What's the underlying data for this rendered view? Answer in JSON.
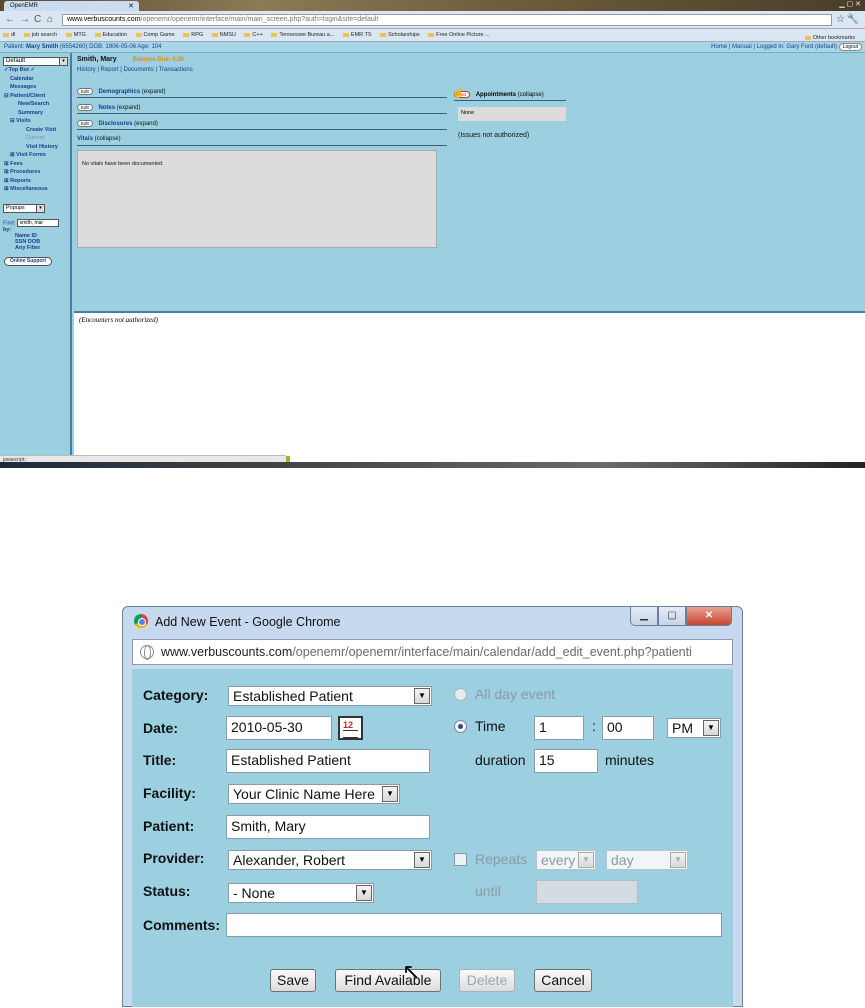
{
  "browser": {
    "tab_title": "OpenEMR",
    "url_domain": "www.verbuscounts.com",
    "url_path": "/openemr/openemr/interface/main/main_screen.php?auth=login&site=default",
    "bookmarks": [
      "dl",
      "job search",
      "MTG",
      "Education",
      "Comp Game",
      "RPG",
      "NMSU",
      "C++",
      "Tennessee Bureau a...",
      "EMR TS",
      "Scholarships",
      "Free Online Picture ..."
    ],
    "other_bookmarks": "Other bookmarks",
    "status_text": "javascript:;"
  },
  "patient_bar": {
    "label": "Patient:",
    "name": "Mary Smith",
    "details": "(6554260) DOB: 1906-05-06 Age: 104",
    "home": "Home",
    "manual": "Manual",
    "logged_in": "Logged in: Gary Ford (default)",
    "logout": "Logout"
  },
  "nav": {
    "view_select": "Default",
    "items": [
      {
        "label": "✓Top      Bot ✓",
        "level": 0
      },
      {
        "label": "Calendar",
        "level": 1
      },
      {
        "label": "Messages",
        "level": 1
      },
      {
        "label": "⊟ Patient/Client",
        "level": 0
      },
      {
        "label": "New/Search",
        "level": 2
      },
      {
        "label": "Summary",
        "level": 2
      },
      {
        "label": "⊟ Visits",
        "level": 1
      },
      {
        "label": "Create Visit",
        "level": 3
      },
      {
        "label": "Current",
        "level": 3,
        "gray": true
      },
      {
        "label": "Visit History",
        "level": 3
      },
      {
        "label": "⊞ Visit Forms",
        "level": 1
      },
      {
        "label": "⊞ Fees",
        "level": 0
      },
      {
        "label": "⊞ Procedures",
        "level": 0
      },
      {
        "label": "⊞ Reports",
        "level": 0
      },
      {
        "label": "⊞ Miscellaneous",
        "level": 0
      }
    ],
    "popups": "Popups",
    "find_label": "Find:",
    "find_value": "smith, mar",
    "by_label": "by:",
    "by_row1": "Name      ID",
    "by_row2": "SSN     DOB",
    "by_row3": "Any    Filter",
    "online_support": "Online Support"
  },
  "main": {
    "patient_name": "Smith, Mary",
    "balance": "Balance Due: 0.00",
    "links": "History | Report | Documents | Transactions",
    "edit": "Edit",
    "demographics": "Demographics",
    "demographics_toggle": "(expand)",
    "notes": "Notes",
    "notes_toggle": "(expand)",
    "disclosures": "Disclosures",
    "disclosures_toggle": "(expand)",
    "vitals": "Vitals",
    "vitals_toggle": "(collapse)",
    "vitals_empty": "No vitals have been documented.",
    "add": "Add",
    "appointments": "Appointments",
    "appointments_toggle": "(collapse)",
    "appointments_none": "None",
    "issues": "(Issues not authorized)",
    "encounters": "(Encounters not authorized)"
  },
  "dialog": {
    "title": "Add New Event - Google Chrome",
    "url_domain": "www.verbuscounts.com",
    "url_path": "/openemr/openemr/interface/main/calendar/add_edit_event.php?patienti",
    "category_label": "Category:",
    "category_value": "Established Patient",
    "date_label": "Date:",
    "date_value": "2010-05-30",
    "title_label": "Title:",
    "title_value": "Established Patient",
    "facility_label": "Facility:",
    "facility_value": "Your Clinic Name Here",
    "patient_label": "Patient:",
    "patient_value": "Smith, Mary",
    "provider_label": "Provider:",
    "provider_value": "Alexander, Robert",
    "status_label": "Status:",
    "status_value": "- None",
    "comments_label": "Comments:",
    "comments_value": "",
    "all_day_label": "All day event",
    "time_label": "Time",
    "hour": "1",
    "colon": ":",
    "minute": "00",
    "ampm": "PM",
    "duration_label": "duration",
    "duration_value": "15",
    "minutes_label": "minutes",
    "repeats_label": "Repeats",
    "repeat_every": "every",
    "repeat_unit": "day",
    "until_label": "until",
    "until_value": "",
    "save": "Save",
    "find_available": "Find Available",
    "delete": "Delete",
    "cancel": "Cancel"
  }
}
